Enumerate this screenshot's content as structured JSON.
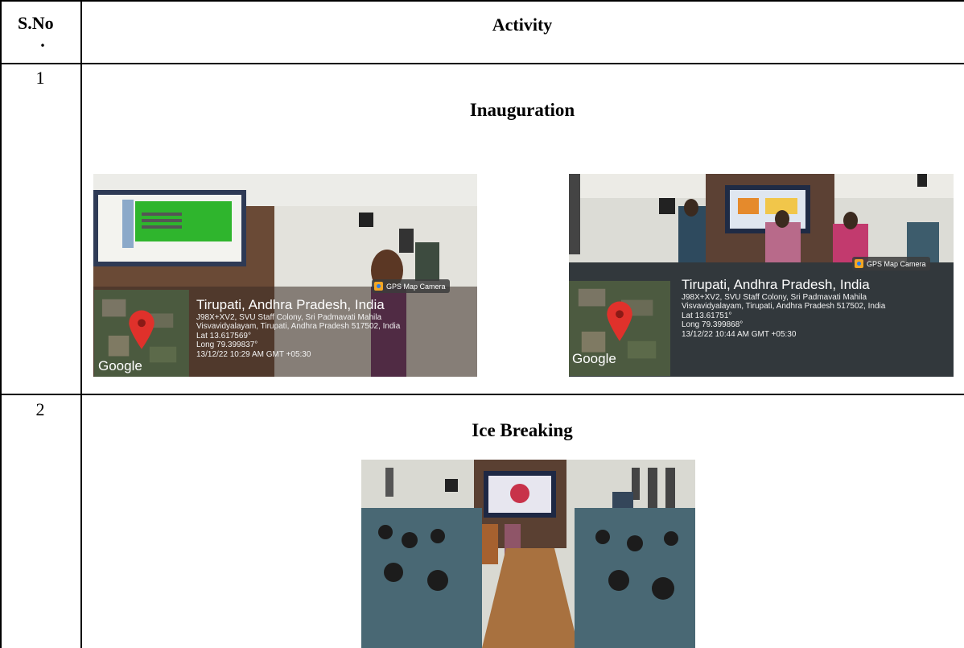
{
  "table": {
    "header_sno": "S.No",
    "header_sno_dot": ".",
    "header_activity": "Activity"
  },
  "rows": [
    {
      "number": "1",
      "title": "Inauguration",
      "photos": [
        {
          "badge": "GPS Map Camera",
          "place": "Tirupati, Andhra Pradesh, India",
          "address_line1": "J98X+XV2, SVU Staff Colony, Sri Padmavati Mahila",
          "address_line2": "Visvavidyalayam, Tirupati, Andhra Pradesh 517502, India",
          "lat": "Lat 13.617569°",
          "long": "Long 79.399837°",
          "timestamp": "13/12/22 10:29 AM GMT +05:30",
          "map_watermark": "Google"
        },
        {
          "badge": "GPS Map Camera",
          "place": "Tirupati, Andhra Pradesh, India",
          "address_line1": "J98X+XV2, SVU Staff Colony, Sri Padmavati Mahila",
          "address_line2": "Visvavidyalayam, Tirupati, Andhra Pradesh 517502, India",
          "lat": "Lat 13.61751°",
          "long": "Long 79.399868°",
          "timestamp": "13/12/22 10:44 AM GMT +05:30",
          "map_watermark": "Google"
        }
      ]
    },
    {
      "number": "2",
      "title": "Ice Breaking"
    }
  ],
  "colors": {
    "border": "#000000",
    "pin_red": "#e0312b",
    "badge_orange": "#f4a623"
  }
}
